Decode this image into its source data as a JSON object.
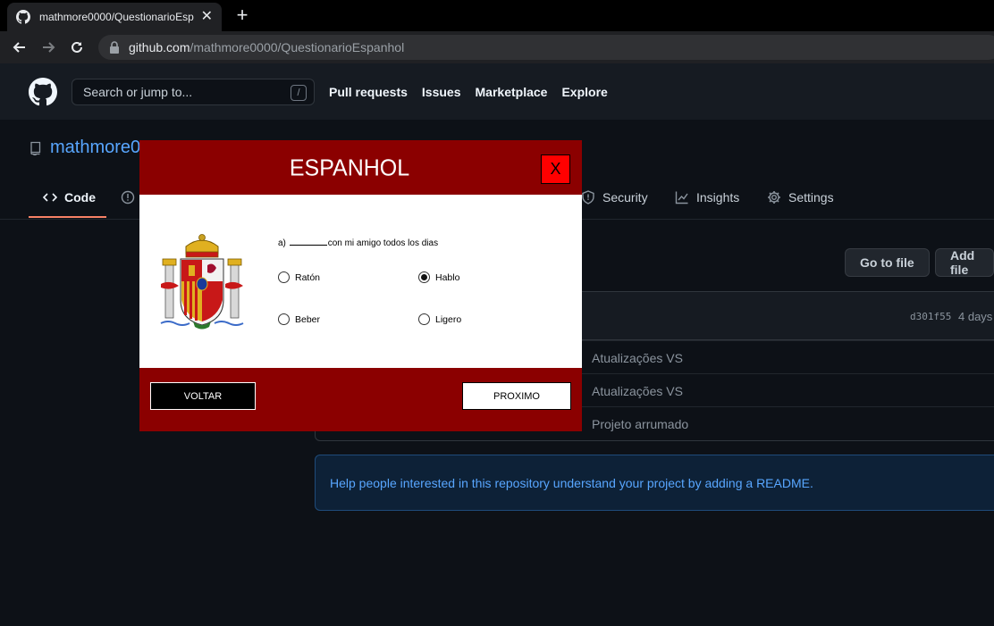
{
  "browser": {
    "tab_title": "mathmore0000/QuestionarioEspanhol",
    "url_host": "github.com",
    "url_path": "/mathmore0000/QuestionarioEspanhol"
  },
  "github": {
    "search_placeholder": "Search or jump to...",
    "search_shortcut": "/",
    "nav": [
      "Pull requests",
      "Issues",
      "Marketplace",
      "Explore"
    ],
    "repo_owner_visible": "mathmore0",
    "tabs": {
      "code": "Code",
      "security": "Security",
      "insights": "Insights",
      "settings": "Settings"
    },
    "buttons": {
      "go_to_file": "Go to file",
      "add_file": "Add file"
    },
    "latest_commit": {
      "hash": "d301f55",
      "age": "4 days"
    },
    "file_commit_messages": [
      "Atualizações VS",
      "Atualizações VS",
      "Projeto arrumado"
    ],
    "readme_prompt": "Help people interested in this repository understand your project by adding a README."
  },
  "dialog": {
    "title": "ESPANHOL",
    "close_label": "X",
    "question_prefix": "a)",
    "question_suffix": "con mi amigo todos los dias",
    "options": [
      {
        "label": "Ratón",
        "selected": false
      },
      {
        "label": "Hablo",
        "selected": true
      },
      {
        "label": "Beber",
        "selected": false
      },
      {
        "label": "Ligero",
        "selected": false
      }
    ],
    "back_label": "VOLTAR",
    "next_label": "PROXIMO",
    "colors": {
      "frame": "#8b0000",
      "close_button": "#ff0000"
    }
  }
}
